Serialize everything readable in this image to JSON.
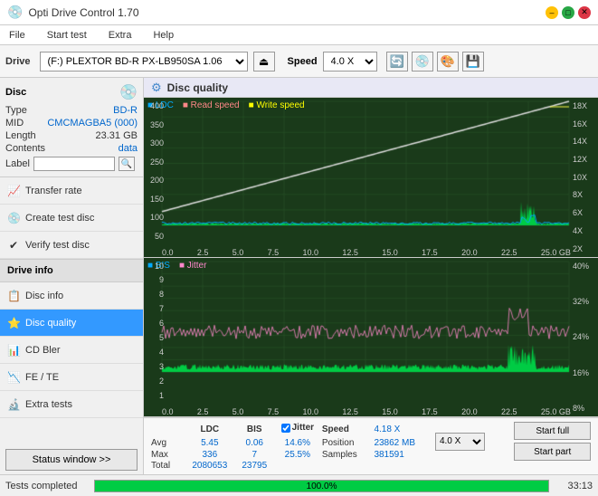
{
  "titlebar": {
    "title": "Opti Drive Control 1.70",
    "icon": "💿",
    "min": "–",
    "max": "□",
    "close": "✕"
  },
  "menubar": {
    "items": [
      "File",
      "Start test",
      "Extra",
      "Help"
    ]
  },
  "drivebar": {
    "drive_label": "Drive",
    "drive_value": "(F:)  PLEXTOR BD-R  PX-LB950SA 1.06",
    "speed_label": "Speed",
    "speed_value": "4.0 X",
    "eject_icon": "⏏"
  },
  "sidebar": {
    "disc_label": "Disc",
    "disc_type_key": "Type",
    "disc_type_val": "BD-R",
    "disc_mid_key": "MID",
    "disc_mid_val": "CMCMAGBA5 (000)",
    "disc_length_key": "Length",
    "disc_length_val": "23.31 GB",
    "disc_contents_key": "Contents",
    "disc_contents_val": "data",
    "disc_label_key": "Label",
    "disc_label_val": "",
    "nav_items": [
      {
        "label": "Transfer rate",
        "icon": "📈",
        "active": false
      },
      {
        "label": "Create test disc",
        "icon": "💿",
        "active": false
      },
      {
        "label": "Verify test disc",
        "icon": "✔",
        "active": false
      },
      {
        "label": "Drive info",
        "icon": "ℹ",
        "active": false
      },
      {
        "label": "Disc info",
        "icon": "📋",
        "active": false
      },
      {
        "label": "Disc quality",
        "icon": "⭐",
        "active": true
      },
      {
        "label": "CD Bler",
        "icon": "📊",
        "active": false
      },
      {
        "label": "FE / TE",
        "icon": "📉",
        "active": false
      },
      {
        "label": "Extra tests",
        "icon": "🔬",
        "active": false
      }
    ],
    "status_btn": "Status window >>"
  },
  "quality": {
    "title": "Disc quality",
    "icon": "⚙",
    "legend": {
      "ldc": "LDC",
      "read": "Read speed",
      "write": "Write speed",
      "bis": "BIS",
      "jitter": "Jitter"
    }
  },
  "stats": {
    "ldc_label": "LDC",
    "bis_label": "BIS",
    "jitter_label": "Jitter",
    "speed_label": "Speed",
    "position_label": "Position",
    "samples_label": "Samples",
    "avg_label": "Avg",
    "max_label": "Max",
    "total_label": "Total",
    "ldc_avg": "5.45",
    "ldc_max": "336",
    "ldc_total": "2080653",
    "bis_avg": "0.06",
    "bis_max": "7",
    "bis_total": "23795",
    "jitter_avg": "14.6%",
    "jitter_max": "25.5%",
    "speed_val": "4.18 X",
    "speed_select": "4.0 X",
    "position_val": "23862 MB",
    "samples_val": "381591",
    "start_full": "Start full",
    "start_part": "Start part"
  },
  "statusbar": {
    "status_text": "Tests completed",
    "progress": 100,
    "progress_label": "100.0%",
    "time": "33:13"
  },
  "colors": {
    "ldc": "#00aaff",
    "bis": "#ff88cc",
    "jitter": "#ff88cc",
    "read_speed": "#ffffff",
    "write_speed": "#ffff00",
    "grid": "#2d5a2d",
    "bg": "#1a3a1a",
    "green_fill": "#00cc44"
  }
}
